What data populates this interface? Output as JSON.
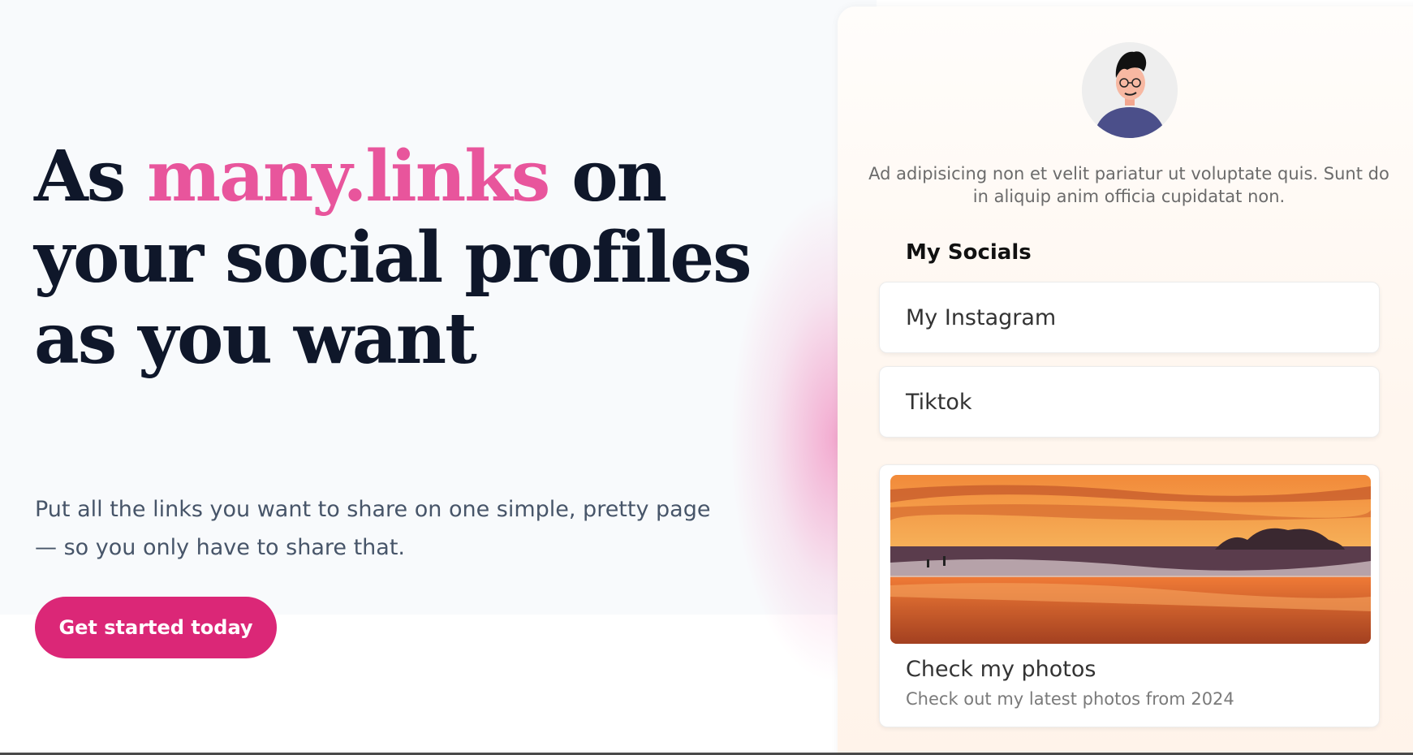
{
  "hero": {
    "headline_before": "As ",
    "headline_accent": "many.links",
    "headline_after": " on your social profiles as you want",
    "subtext": "Put all the links you want to share on one simple, pretty page — so you only have to share that.",
    "cta_label": "Get started today"
  },
  "profile": {
    "bio": "Ad adipisicing non et velit pariatur ut voluptate quis. Sunt do in aliquip anim officia cupidatat non.",
    "section_title": "My Socials",
    "links": [
      {
        "label": "My Instagram"
      },
      {
        "label": "Tiktok"
      }
    ],
    "photo_card": {
      "title": "Check my photos",
      "subtitle": "Check out my latest photos from 2024"
    }
  },
  "colors": {
    "accent": "#e8559c",
    "button": "#db2777",
    "heading": "#0f172a",
    "body": "#475569"
  },
  "icons": {
    "avatar": "cartoon-person-avatar",
    "photo": "sunset-beach-photo"
  }
}
